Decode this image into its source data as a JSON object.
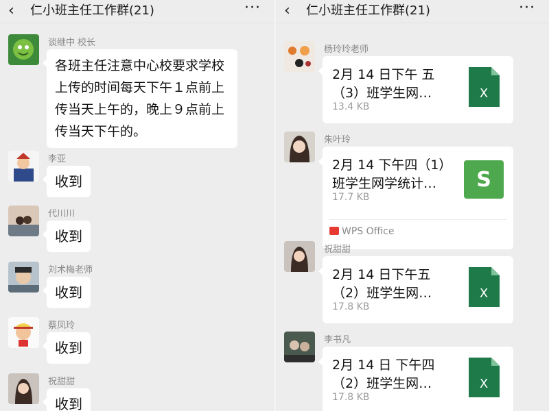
{
  "left": {
    "title": "仁小班主任工作群(21)",
    "back_icon": "‹",
    "more_icon": "···",
    "messages": [
      {
        "sender": "谈继中 校长",
        "text": "各班主任注意中心校要求学校上传的时间每天下午１点前上传当天上午的，晚上９点前上传当天下午的。"
      },
      {
        "sender": "李亚",
        "text": "收到"
      },
      {
        "sender": "代川川",
        "text": "收到"
      },
      {
        "sender": "刘术梅老师",
        "text": "收到"
      },
      {
        "sender": "蔡凤玲",
        "text": "收到"
      },
      {
        "sender": "祝甜甜",
        "text": "收到"
      }
    ]
  },
  "right": {
    "title": "仁小班主任工作群(21)",
    "back_icon": "‹",
    "more_icon": "···",
    "messages": [
      {
        "sender": "杨玲玲老师",
        "file_name": "2月 14 日下午 五（3）班学生网…",
        "file_size": "13.4 KB",
        "icon": "excel-icon"
      },
      {
        "sender": "朱叶玲",
        "file_name": "2月 14 下午四（1）班学生网学统计…",
        "file_size": "17.7 KB",
        "icon": "wps-spreadsheet-icon",
        "app_label": "WPS  Office"
      },
      {
        "sender": "祝甜甜",
        "file_name": "2月 14 日下午五（2）班学生网…",
        "file_size": "17.8 KB",
        "icon": "excel-icon"
      },
      {
        "sender": "李书凡",
        "file_name": "2月 14 日  下午四（2）班学生网…",
        "file_size": "17.8 KB",
        "icon": "excel-icon"
      }
    ]
  },
  "colors": {
    "background": "#ededed",
    "bubble": "#ffffff",
    "excel_green": "#1f7a4a",
    "wps_green": "#4ea84e",
    "wps_red": "#e63a32"
  }
}
